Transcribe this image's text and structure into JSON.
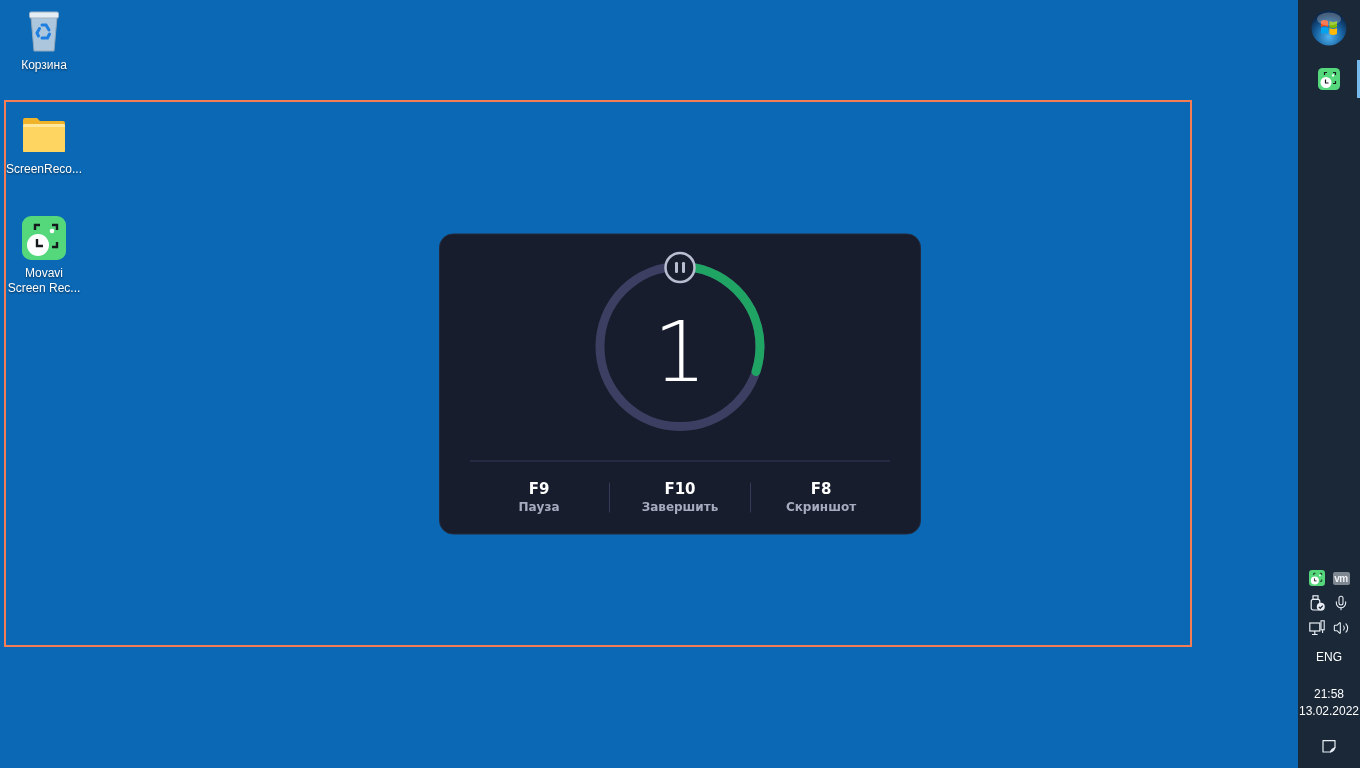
{
  "desktop": {
    "icons": [
      {
        "kind": "recycle-bin",
        "label": "Корзина"
      },
      {
        "kind": "folder",
        "label": "ScreenReco..."
      },
      {
        "kind": "recorder",
        "label": "Movavi Screen Rec..."
      }
    ]
  },
  "countdown": {
    "number": "1",
    "level": 0.3,
    "hotkeys": [
      {
        "key": "F9",
        "label": "Пауза"
      },
      {
        "key": "F10",
        "label": "Завершить"
      },
      {
        "key": "F8",
        "label": "Скриншот"
      }
    ]
  },
  "taskbar": {
    "apps": [
      {
        "kind": "recorder",
        "running": true
      }
    ],
    "tray": {
      "icons": [
        {
          "kind": "recorder"
        },
        {
          "kind": "badge",
          "text": "vm"
        },
        {
          "kind": "usb"
        },
        {
          "kind": "microphone"
        },
        {
          "kind": "network"
        },
        {
          "kind": "volume"
        }
      ],
      "language": "ENG",
      "time": "21:58",
      "date": "13.02.2022"
    }
  }
}
